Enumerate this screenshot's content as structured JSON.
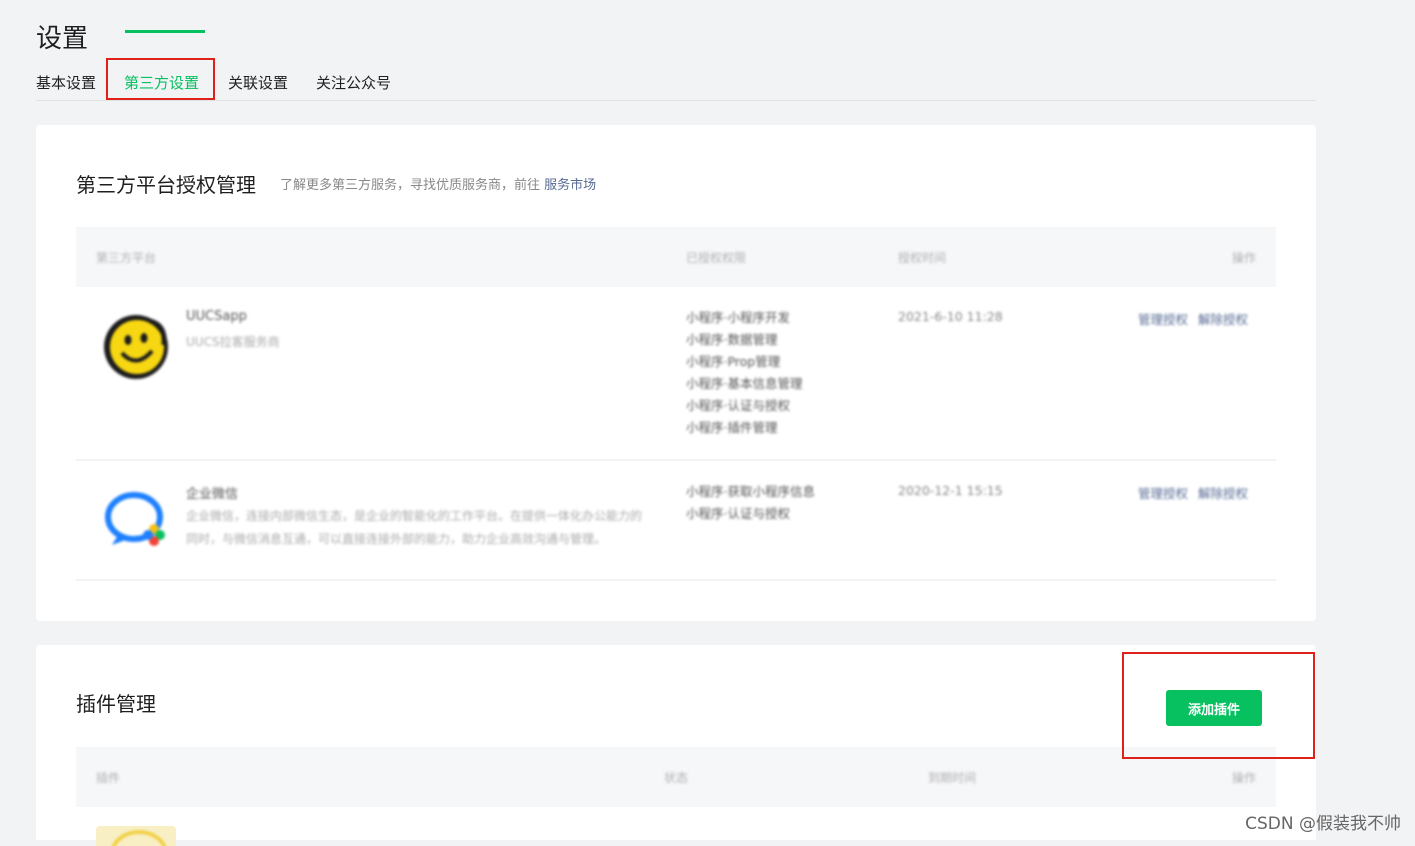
{
  "page": {
    "title": "设置"
  },
  "tabs": [
    {
      "label": "基本设置"
    },
    {
      "label": "第三方设置"
    },
    {
      "label": "关联设置"
    },
    {
      "label": "关注公众号"
    }
  ],
  "third_party": {
    "title": "第三方平台授权管理",
    "subtitle": "了解更多第三方服务，寻找优质服务商，前往",
    "market_link": "服务市场",
    "columns": [
      "第三方平台",
      "已授权权限",
      "授权时间",
      "操作"
    ],
    "rows": [
      {
        "name": "UUCSapp",
        "desc": "UUCS拉客服务商",
        "permissions": [
          "小程序·小程序开发",
          "小程序·数据管理",
          "小程序·Prop管理",
          "小程序·基本信息管理",
          "小程序·认证与授权",
          "小程序·插件管理"
        ],
        "time": "2021-6-10 11:28",
        "actions": [
          "管理授权",
          "解除授权"
        ]
      },
      {
        "name": "企业微信",
        "desc": "企业微信，连接内部微信生态，是企业的智能化的工作平台。在提供一体化办公能力的同时，与微信消息互通，可以直接连接外部的能力，助力企业高效沟通与管理。",
        "permissions": [
          "小程序·获取小程序信息",
          "小程序·认证与授权"
        ],
        "time": "2020-12-1 15:15",
        "actions": [
          "管理授权",
          "解除授权"
        ]
      }
    ],
    "avatar_colors": {
      "smiley": "#f6d712",
      "bubble": "#1e80ff"
    }
  },
  "plugins": {
    "title": "插件管理",
    "add_button": "添加插件",
    "columns": [
      "插件",
      "状态",
      "到期时间",
      "操作"
    ]
  },
  "watermark": "CSDN @假装我不帅",
  "colors": {
    "accent": "#07c160",
    "highlight": "#e0201b",
    "link": "#576b95"
  }
}
